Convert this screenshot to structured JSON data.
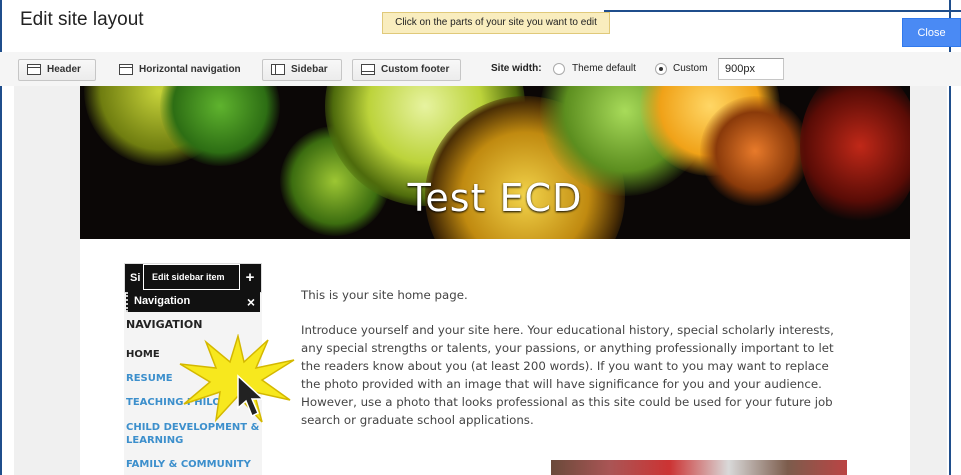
{
  "window": {
    "title": "Edit site layout",
    "hint": "Click on the parts of your site you want to edit",
    "close_label": "Close"
  },
  "toolbar": {
    "header_label": "Header",
    "horizontal_nav_label": "Horizontal navigation",
    "sidebar_label": "Sidebar",
    "custom_footer_label": "Custom footer",
    "site_width_label": "Site width:",
    "theme_default_label": "Theme default",
    "custom_label": "Custom",
    "width_value": "900px",
    "selected_width_option": "Custom"
  },
  "site": {
    "title": "Test ECD",
    "sidebar": {
      "box_title_visible": "Si",
      "edit_tooltip": "Edit sidebar item",
      "add_symbol": "+",
      "navigation_bar_label": "Navigation",
      "remove_symbol": "×",
      "section_heading": "NAVIGATION",
      "items": [
        {
          "label": "HOME"
        },
        {
          "label": "RESUME"
        },
        {
          "label": "TEACHING PHILOS"
        },
        {
          "label": "CHILD DEVELOPMENT &"
        },
        {
          "label": "LEARNING"
        },
        {
          "label": "FAMILY & COMMUNITY"
        }
      ]
    },
    "content": {
      "intro": "This is your site home page.",
      "lines": [
        "Introduce yourself and your site here. Your educational history, special scholarly interests,",
        "any special strengths or talents, your passions, or anything professionally important to let",
        "the readers know about you (at least 200 words). If you want to you may want to replace",
        "the photo provided with an image that will have significance for you and your audience.",
        "However, use a photo that looks professional as this site could be used for your future job",
        "search or graduate school applications."
      ]
    }
  },
  "colors": {
    "close_button": "#4a8af4",
    "nav_link": "#3c8fcc",
    "hint_banner": "#f9edbe",
    "highlight_starburst": "#f7e81e"
  },
  "icons": {
    "header": "header-layout-icon",
    "nav": "nav-layout-icon",
    "sidebar": "sidebar-layout-icon",
    "footer": "footer-layout-icon",
    "cursor": "mouse-pointer-icon",
    "burst": "starburst-highlight-icon"
  }
}
